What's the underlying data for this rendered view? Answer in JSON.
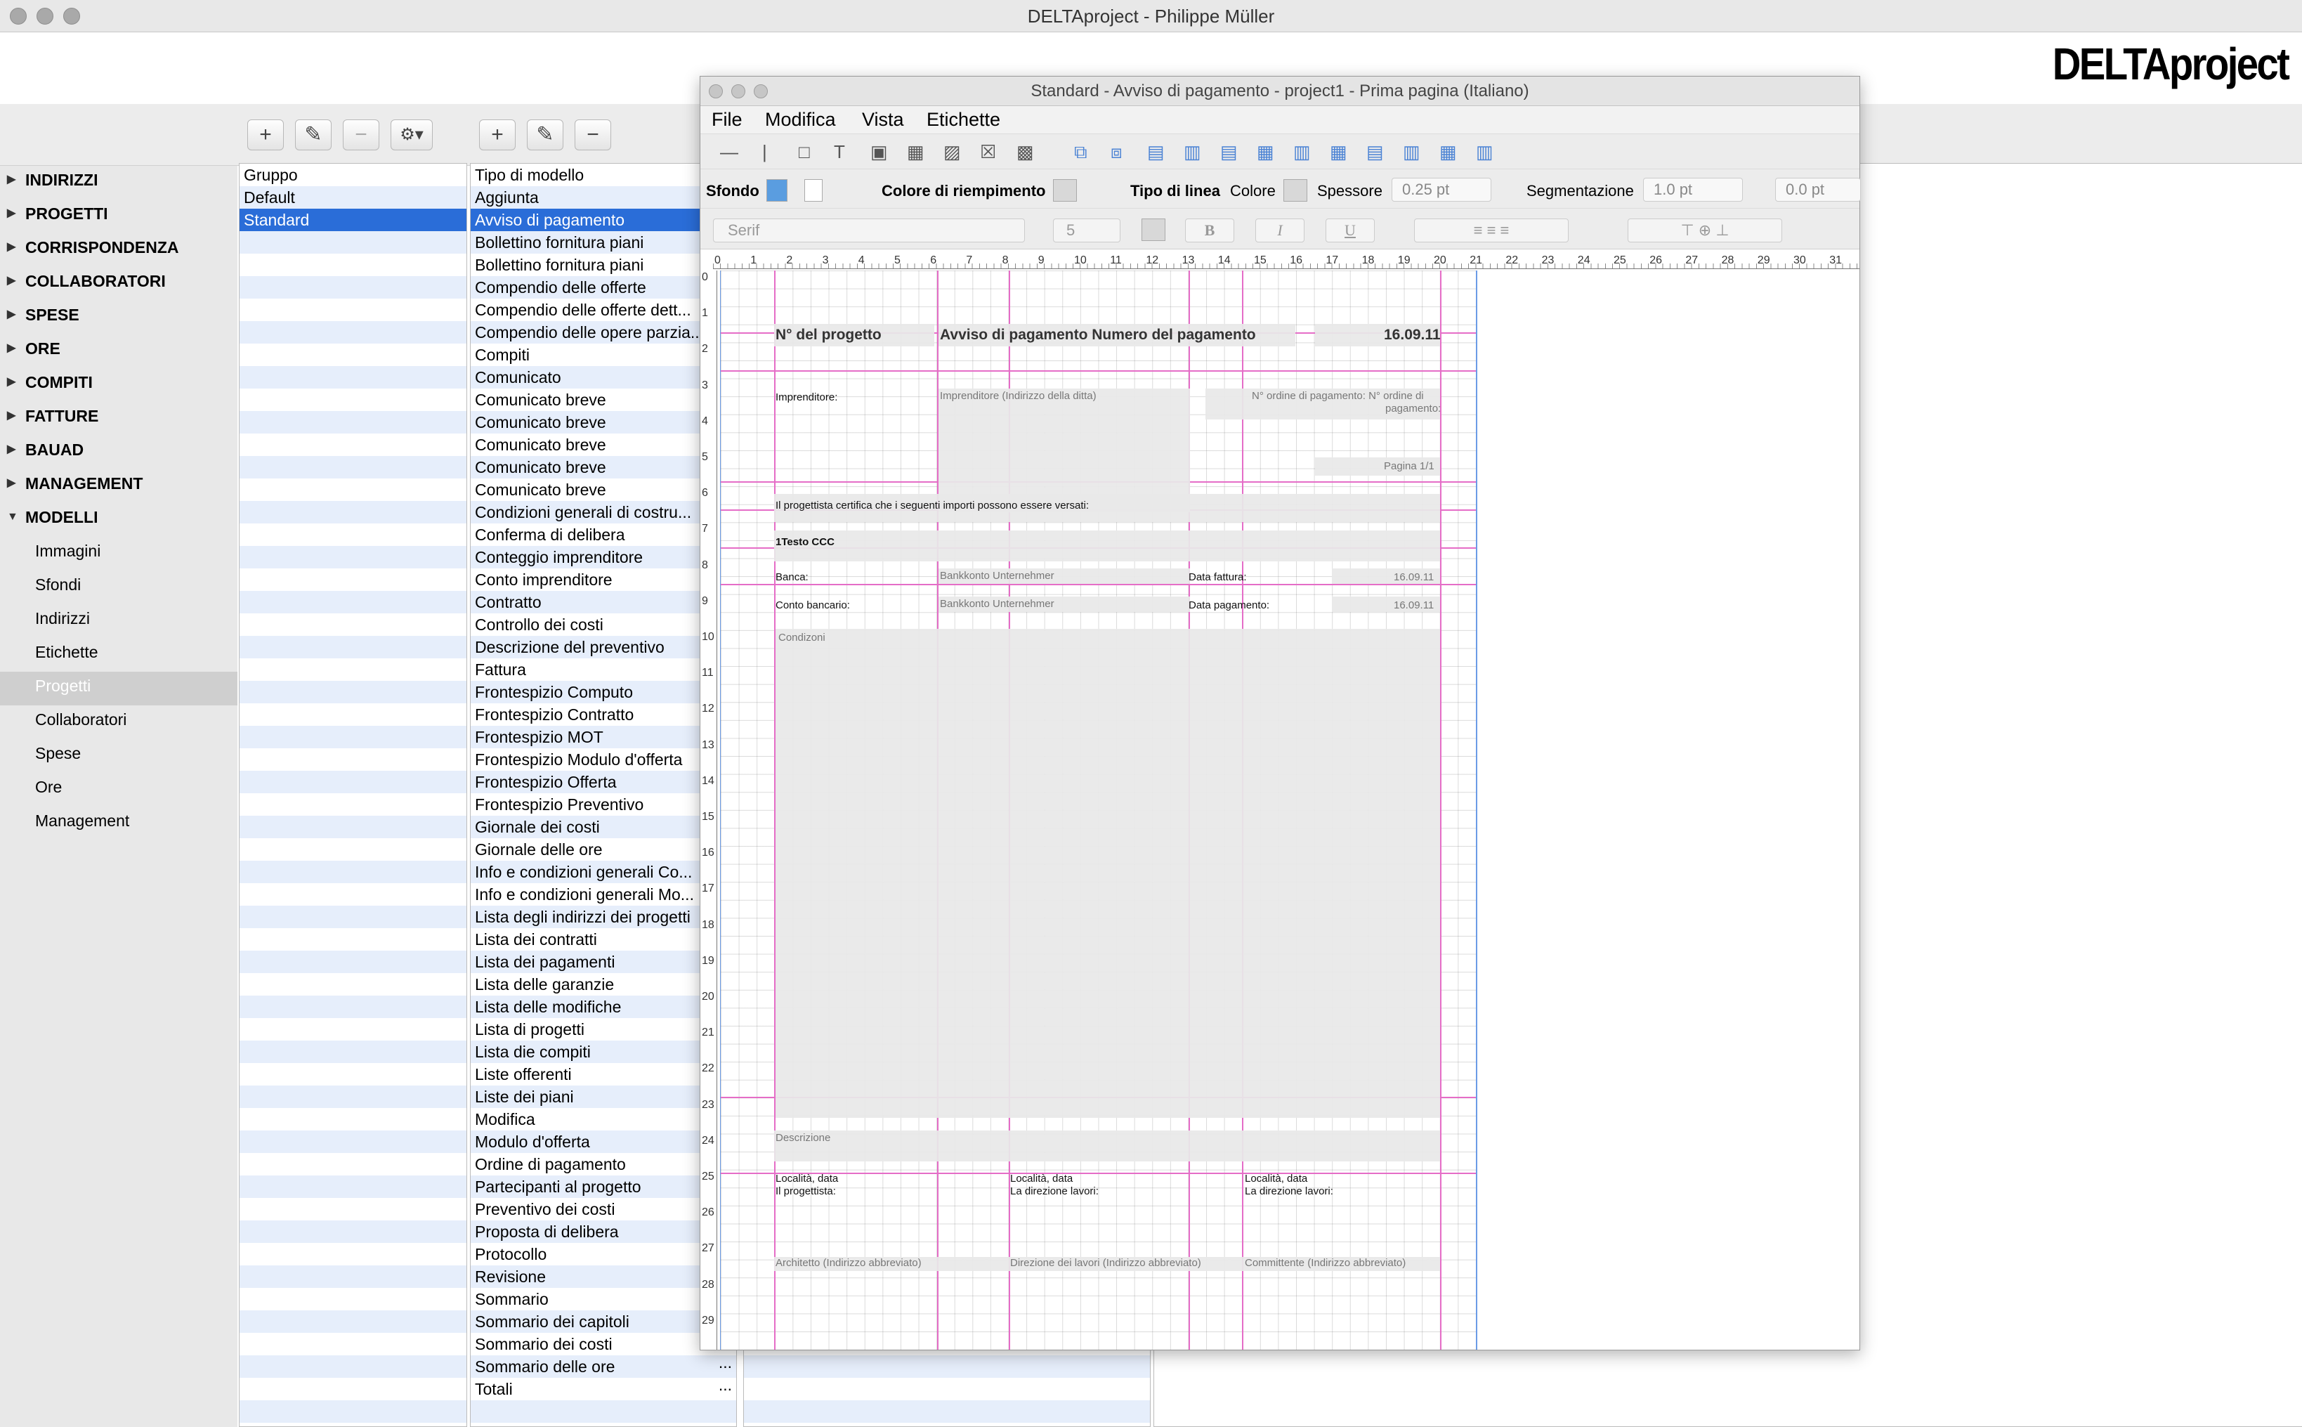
{
  "window": {
    "title": "DELTAproject - Philippe Müller",
    "logo": "DELTAproject"
  },
  "icons": {
    "add": "plus-icon",
    "edit": "pencil-icon",
    "remove": "minus-icon",
    "settings": "gear-icon",
    "add_glyph": "+",
    "edit_glyph": "✎",
    "remove_glyph": "−",
    "settings_glyph": "⚙▾"
  },
  "colors": {
    "selection": "#2a6dd8",
    "guide": "#e56dc7",
    "page_border": "#6b9be6"
  },
  "sidebar": {
    "items": [
      "INDIRIZZI",
      "PROGETTI",
      "CORRISPONDENZA",
      "COLLABORATORI",
      "SPESE",
      "ORE",
      "COMPITI",
      "FATTURE",
      "BAUAD",
      "MANAGEMENT"
    ],
    "expanded": "MODELLI",
    "sub_items": [
      "Immagini",
      "Sfondi",
      "Indirizzi",
      "Etichette",
      "Progetti",
      "Collaboratori",
      "Spese",
      "Ore",
      "Management"
    ],
    "selected_sub": "Progetti"
  },
  "groups": {
    "header": "Gruppo",
    "items": [
      "Default",
      "Standard"
    ],
    "selected": "Standard"
  },
  "models": {
    "header": "Tipo di modello",
    "items": [
      "Aggiunta",
      "Avviso di pagamento",
      "Bollettino fornitura piani",
      "Bollettino fornitura piani",
      "Compendio delle offerte",
      "Compendio delle offerte dett...",
      "Compendio delle opere parzia...",
      "Compiti",
      "Comunicato",
      "Comunicato breve",
      "Comunicato breve",
      "Comunicato breve",
      "Comunicato breve",
      "Comunicato breve",
      "Condizioni generali di costru...",
      "Conferma di delibera",
      "Conteggio imprenditore",
      "Conto imprenditore",
      "Contratto",
      "Controllo dei costi",
      "Descrizione del preventivo",
      "Fattura",
      "Frontespizio Computo",
      "Frontespizio Contratto",
      "Frontespizio MOT",
      "Frontespizio Modulo d'offerta",
      "Frontespizio Offerta",
      "Frontespizio Preventivo",
      "Giornale dei costi",
      "Giornale delle ore",
      "Info e condizioni generali Co...",
      "Info e condizioni generali Mo...",
      "Lista degli indirizzi dei progetti",
      "Lista dei contratti",
      "Lista dei pagamenti",
      "Lista delle garanzie",
      "Lista delle modifiche",
      "Lista di progetti",
      "Lista die compiti",
      "Liste offerenti",
      "Liste dei piani",
      "Modifica",
      "Modulo d'offerta",
      "Ordine di pagamento",
      "Partecipanti al progetto",
      "Preventivo dei costi",
      "Proposta di delibera",
      "Protocollo",
      "Revisione",
      "Sommario",
      "Sommario dei capitoli",
      "Sommario dei costi",
      "Sommario delle ore",
      "Totali"
    ],
    "selected": "Avviso di pagamento",
    "ellipsis": "..."
  },
  "editor": {
    "title": "Standard - Avviso di pagamento  - project1 - Prima pagina (Italiano)",
    "menus": [
      "File",
      "Modifica",
      "Vista",
      "Etichette"
    ],
    "toolbar_icons": [
      "line-tool-icon",
      "vertical-line-tool-icon",
      "rectangle-tool-icon",
      "text-tool-icon",
      "field-tool-icon",
      "table-tool-icon",
      "image-tool-icon",
      "placeholder-tool-icon",
      "picture-tool-icon",
      "bring-front-icon",
      "send-back-icon",
      "align-left-icon",
      "align-center-icon",
      "align-right-icon",
      "align-top-icon",
      "align-middle-icon",
      "align-bottom-icon",
      "distribute-h-icon",
      "distribute-h2-icon",
      "distribute-v-icon",
      "distribute-v2-icon"
    ],
    "toolbar_glyphs": [
      "—",
      "|",
      "□",
      "T",
      "▣",
      "▦",
      "▨",
      "☒",
      "▩",
      "⧉",
      "⧈",
      "▤",
      "▥",
      "▤",
      "▦",
      "▥",
      "▦",
      "▤",
      "▥",
      "▦",
      "▥"
    ],
    "props": {
      "background_label": "Sfondo",
      "fill_label": "Colore di riempimento",
      "line_type_label": "Tipo di linea",
      "color_label": "Colore",
      "thickness_label": "Spessore",
      "thickness_value": "0.25 pt",
      "segmentation_label": "Segmentazione",
      "segmentation_value": "1.0 pt",
      "offset_value": "0.0 pt"
    },
    "font": {
      "family": "Serif",
      "size": "5",
      "bold": "B",
      "italic": "I",
      "underline": "U"
    },
    "ruler": [
      "0",
      "1",
      "2",
      "3",
      "4",
      "5",
      "6",
      "7",
      "8",
      "9",
      "10",
      "11",
      "12",
      "13",
      "14",
      "15",
      "16",
      "17",
      "18",
      "19",
      "20",
      "21",
      "22",
      "23",
      "24",
      "25",
      "26",
      "27",
      "28",
      "29",
      "30",
      "31"
    ],
    "vruler": [
      "0",
      "1",
      "2",
      "3",
      "4",
      "5",
      "6",
      "7",
      "8",
      "9",
      "10",
      "11",
      "12",
      "13",
      "14",
      "15",
      "16",
      "17",
      "18",
      "19",
      "20",
      "21",
      "22",
      "23",
      "24",
      "25",
      "26",
      "27",
      "28",
      "29"
    ]
  },
  "doc": {
    "project_no": "N° del progetto",
    "heading": "Avviso di pagamento Numero del pagamento",
    "date": "16.09.11",
    "contractor_label": "Imprenditore:",
    "contractor_address": "Imprenditore (Indirizzo della ditta)",
    "order_no_1": "N° ordine di pagamento: N° ordine di",
    "order_no_2": "pagamento:",
    "page": "Pagina 1/1",
    "certify": "Il progettista certifica che i seguenti importi possono essere versati:",
    "text_ccc": "1Testo CCC",
    "bank_label": "Banca:",
    "bank_value": "Bankkonto Unternehmer",
    "invoice_date_label": "Data fattura:",
    "invoice_date": "16.09.11",
    "account_label": "Conto bancario:",
    "account_value": "Bankkonto Unternehmer",
    "payment_date_label": "Data pagamento:",
    "payment_date": "16.09.11",
    "conditions": "Condizoni",
    "description": "Descrizione",
    "place_date": "Località, data",
    "designer": "Il progettista:",
    "site_mgmt": "La direzione lavori:",
    "footer_1": "Architetto (Indirizzo abbreviato)",
    "footer_2": "Direzione dei lavori (Indirizzo abbreviato)",
    "footer_3": "Committente (Indirizzo abbreviato)"
  }
}
